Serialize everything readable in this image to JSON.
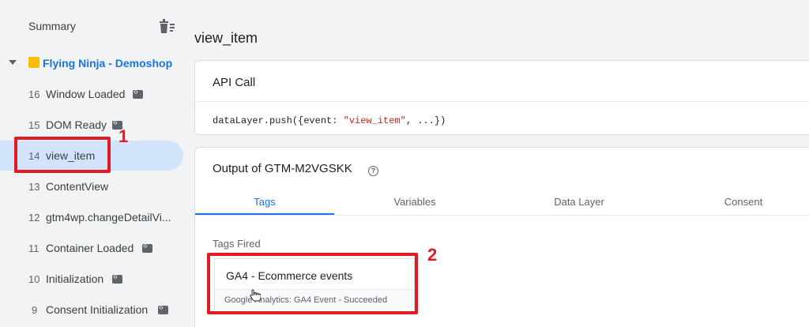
{
  "sidebar": {
    "summary_label": "Summary",
    "container_label": "Flying Ninja - Demoshop",
    "events": [
      {
        "num": "16",
        "label": "Window Loaded",
        "has_code_icon": true
      },
      {
        "num": "15",
        "label": "DOM Ready",
        "has_code_icon": true
      },
      {
        "num": "14",
        "label": "view_item",
        "has_code_icon": false
      },
      {
        "num": "13",
        "label": "ContentView",
        "has_code_icon": false
      },
      {
        "num": "12",
        "label": "gtm4wp.changeDetailVi...",
        "has_code_icon": false
      },
      {
        "num": "11",
        "label": "Container Loaded",
        "has_code_icon": true
      },
      {
        "num": "10",
        "label": "Initialization",
        "has_code_icon": true
      },
      {
        "num": "9",
        "label": "Consent Initialization",
        "has_code_icon": true
      }
    ]
  },
  "main": {
    "page_title": "view_item",
    "api_card": {
      "title": "API Call",
      "code_prefix": "dataLayer.push({event: ",
      "code_string": "\"view_item\"",
      "code_suffix": ", ...})"
    },
    "output_card": {
      "title": "Output of GTM-M2VGSKK",
      "tabs": [
        "Tags",
        "Variables",
        "Data Layer",
        "Consent"
      ],
      "active_tab": "Tags",
      "section_label": "Tags Fired",
      "tag": {
        "name": "GA4 - Ecommerce events",
        "status": "Google Analytics: GA4 Event - Succeeded"
      }
    }
  },
  "annotations": {
    "badge_1": "1",
    "badge_2": "2"
  },
  "colors": {
    "accent": "#1a73e8",
    "highlight": "#e01b24",
    "active_row": "#d2e3fc",
    "folder": "#fbbc04"
  }
}
